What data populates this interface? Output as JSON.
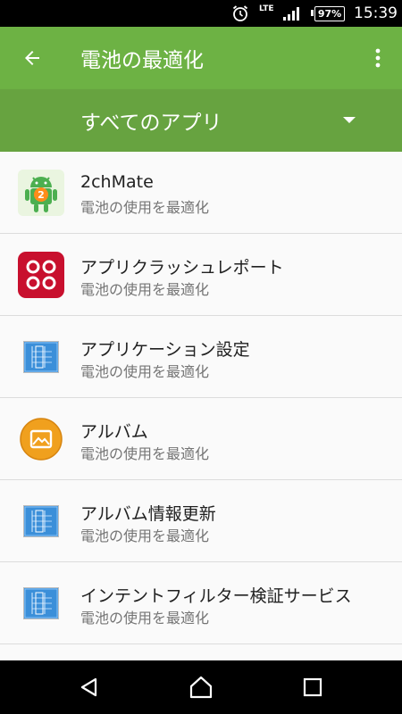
{
  "status_bar": {
    "network": "LTE",
    "battery": "97%",
    "time": "15:39"
  },
  "toolbar": {
    "title": "電池の最適化"
  },
  "filter": {
    "selected": "すべてのアプリ"
  },
  "apps": [
    {
      "name": "2chMate",
      "status": "電池の使用を最適化",
      "icon": "2chmate-icon"
    },
    {
      "name": "アプリクラッシュレポート",
      "status": "電池の使用を最適化",
      "icon": "crash-report-icon"
    },
    {
      "name": "アプリケーション設定",
      "status": "電池の使用を最適化",
      "icon": "blueprint-icon"
    },
    {
      "name": "アルバム",
      "status": "電池の使用を最適化",
      "icon": "album-icon"
    },
    {
      "name": "アルバム情報更新",
      "status": "電池の使用を最適化",
      "icon": "blueprint-icon"
    },
    {
      "name": "インテントフィルター検証サービス",
      "status": "電池の使用を最適化",
      "icon": "blueprint-icon"
    }
  ],
  "colors": {
    "toolbar": "#6db244",
    "filter_bar": "#67a340",
    "crash_report": "#c8102e",
    "album": "#f0a01e",
    "blueprint": "#3b8fd9"
  }
}
